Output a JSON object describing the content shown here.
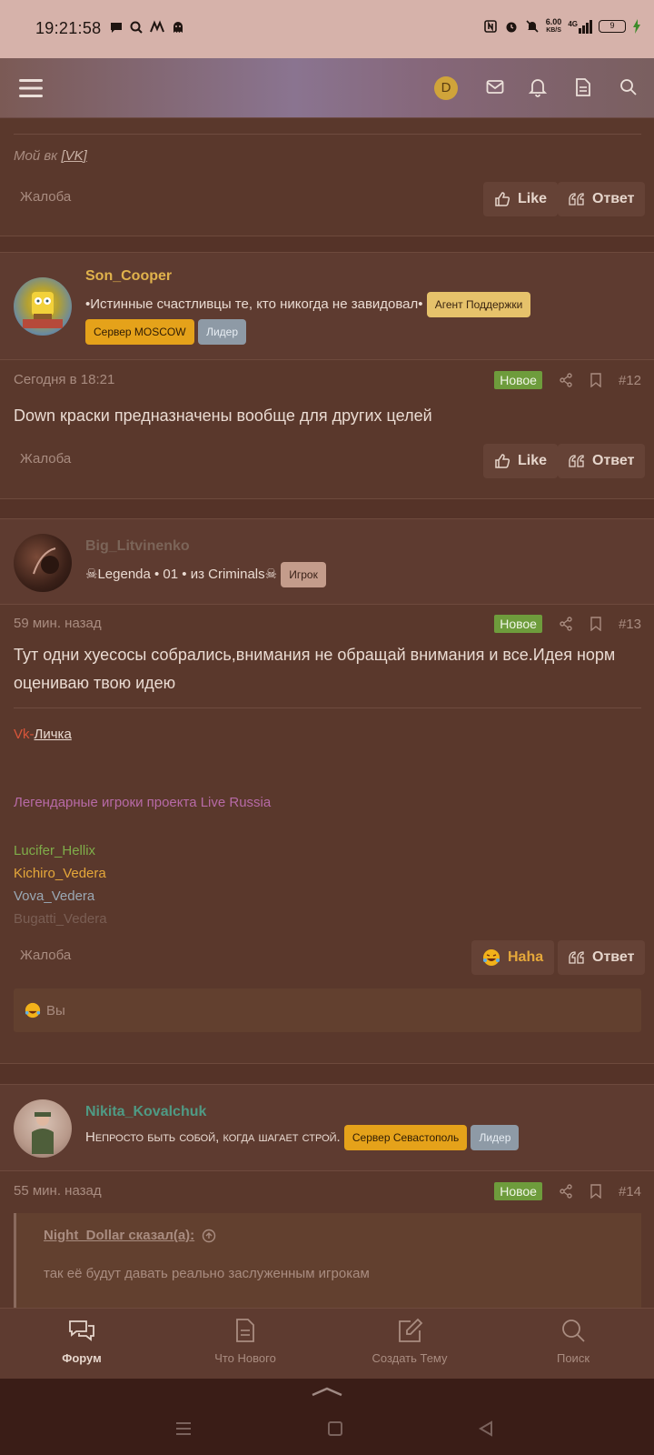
{
  "status_bar": {
    "time": "19:21:58",
    "net_speed_top": "6.00",
    "net_speed_bottom": "KB/S",
    "net_type": "4G",
    "battery": "9"
  },
  "top_nav": {
    "avatar_letter": "D"
  },
  "post11": {
    "signature_prefix": "Мой вк",
    "signature_link": "[VK]",
    "report_label": "Жалоба",
    "like_label": "Like",
    "reply_label": "Ответ"
  },
  "post12": {
    "username": "Son_Cooper",
    "user_title": "•Истинные счастливцы те, кто никогда не завидовал•",
    "badge_support": "Агент Поддержки",
    "badge_server": "Сервер MOSCOW",
    "badge_role": "Лидер",
    "time": "Сегодня в 18:21",
    "new_label": "Новое",
    "number": "#12",
    "text": "Down краски предназначены вообще для других целей",
    "report_label": "Жалоба",
    "like_label": "Like",
    "reply_label": "Ответ"
  },
  "post13": {
    "username": "Big_Litvinenko",
    "user_title": "☠Legenda • 01 • из Criminals☠",
    "badge_role": "Игрок",
    "time": "59 мин. назад",
    "new_label": "Новое",
    "number": "#13",
    "text_line1": "Тут одни хуесосы собрались,внимания не обращай внимания и все.Идея норм",
    "text_line2": "оцениваю твою идею",
    "sig_vk": "Vk",
    "sig_sep": "-",
    "sig_link": "Личка",
    "sig_legend": "Легендарные игроки проекта Live Russia",
    "sig_players": [
      "Lucifer_Hellix",
      "Kichiro_Vedera",
      "Vova_Vedera",
      "Bugatti_Vedera"
    ],
    "report_label": "Жалоба",
    "reaction_label": "Haha",
    "reply_label": "Ответ",
    "reaction_by": "Вы"
  },
  "post14": {
    "username": "Nikita_Kovalchuk",
    "user_title": "Непросто быть собой, когда шагает строй.",
    "badge_server": "Сервер Севастополь",
    "badge_role": "Лидер",
    "time": "55 мин. назад",
    "new_label": "Новое",
    "number": "#14",
    "quote_author": "Night_Dollar сказал(а):",
    "quote_text": "так её будут давать реально заслуженным игрокам"
  },
  "bottom_nav": {
    "forum": "Форум",
    "whats_new": "Что Нового",
    "create_topic": "Создать Тему",
    "search": "Поиск"
  },
  "colors": {
    "background": "#553328",
    "accent_yellow": "#e5a21a",
    "new_badge": "#6e9c3c",
    "username_son": "#e0b24c",
    "username_nikita": "#4f9a84"
  }
}
